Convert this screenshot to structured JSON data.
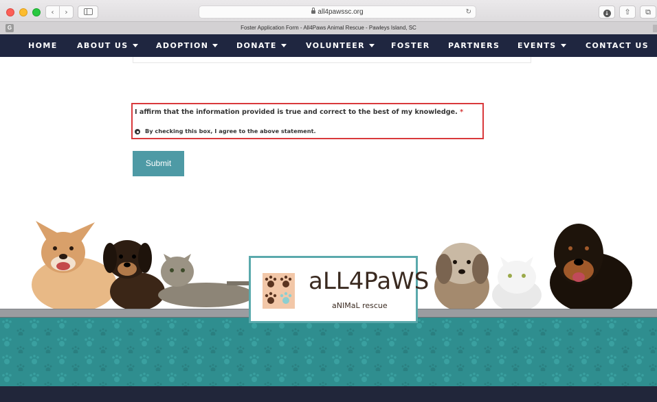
{
  "browser": {
    "url": "all4pawssc.org",
    "tab_title": "Foster Application Form - All4Paws Animal Rescue - Pawleys Island, SC",
    "tab_favicon": "G",
    "back_glyph": "‹",
    "forward_glyph": "›",
    "reload_glyph": "↻",
    "download_glyph": "↓",
    "share_glyph": "⇧",
    "tabs_glyph": "⧉"
  },
  "nav": {
    "items": [
      {
        "label": "HOME"
      },
      {
        "label": "ABOUT US"
      },
      {
        "label": "ADOPTION"
      },
      {
        "label": "DONATE"
      },
      {
        "label": "VOLUNTEER"
      },
      {
        "label": "FOSTER"
      },
      {
        "label": "PARTNERS"
      },
      {
        "label": "EVENTS"
      },
      {
        "label": "CONTACT US"
      }
    ]
  },
  "form": {
    "affirm_label": "I affirm that the information provided is true and correct to the best of my knowledge.",
    "required_mark": "*",
    "agree_label": "By checking this box, I agree to the above statement.",
    "submit_label": "Submit"
  },
  "footer": {
    "logo_main": "aLL4PaWS",
    "logo_sub": "aNIMaL rescue"
  },
  "colors": {
    "nav_bg": "#1f2640",
    "submit_bg": "#4e9aa5",
    "highlight_border": "#d9383b",
    "teal_band": "#2f8e8f",
    "required": "#d63838"
  },
  "icons": {
    "lock": "lock-icon",
    "reload": "reload-icon",
    "download": "download-icon",
    "share": "share-icon",
    "tabs": "tabs-icon",
    "sidebar": "sidebar-icon",
    "paw": "paw-icon"
  }
}
